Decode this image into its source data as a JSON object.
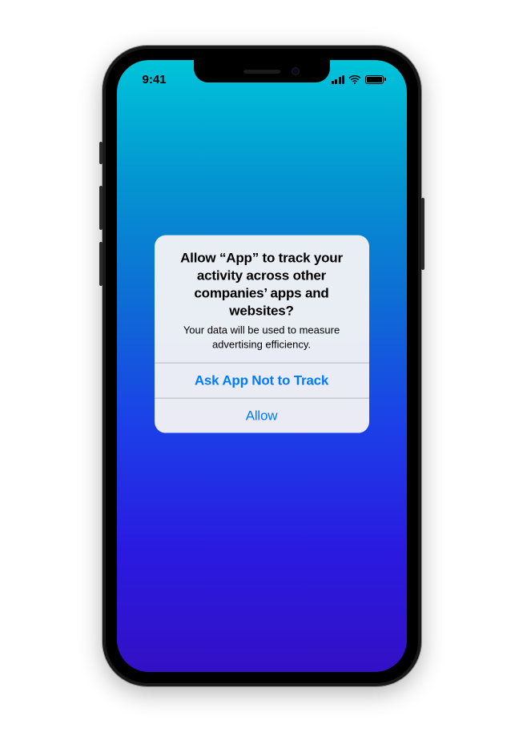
{
  "status_bar": {
    "time": "9:41"
  },
  "alert": {
    "title": "Allow “App” to track your activity across other companies’ apps and websites?",
    "message": "Your data will be used to measure advertising efficiency.",
    "button_deny": "Ask App Not to Track",
    "button_allow": "Allow"
  }
}
